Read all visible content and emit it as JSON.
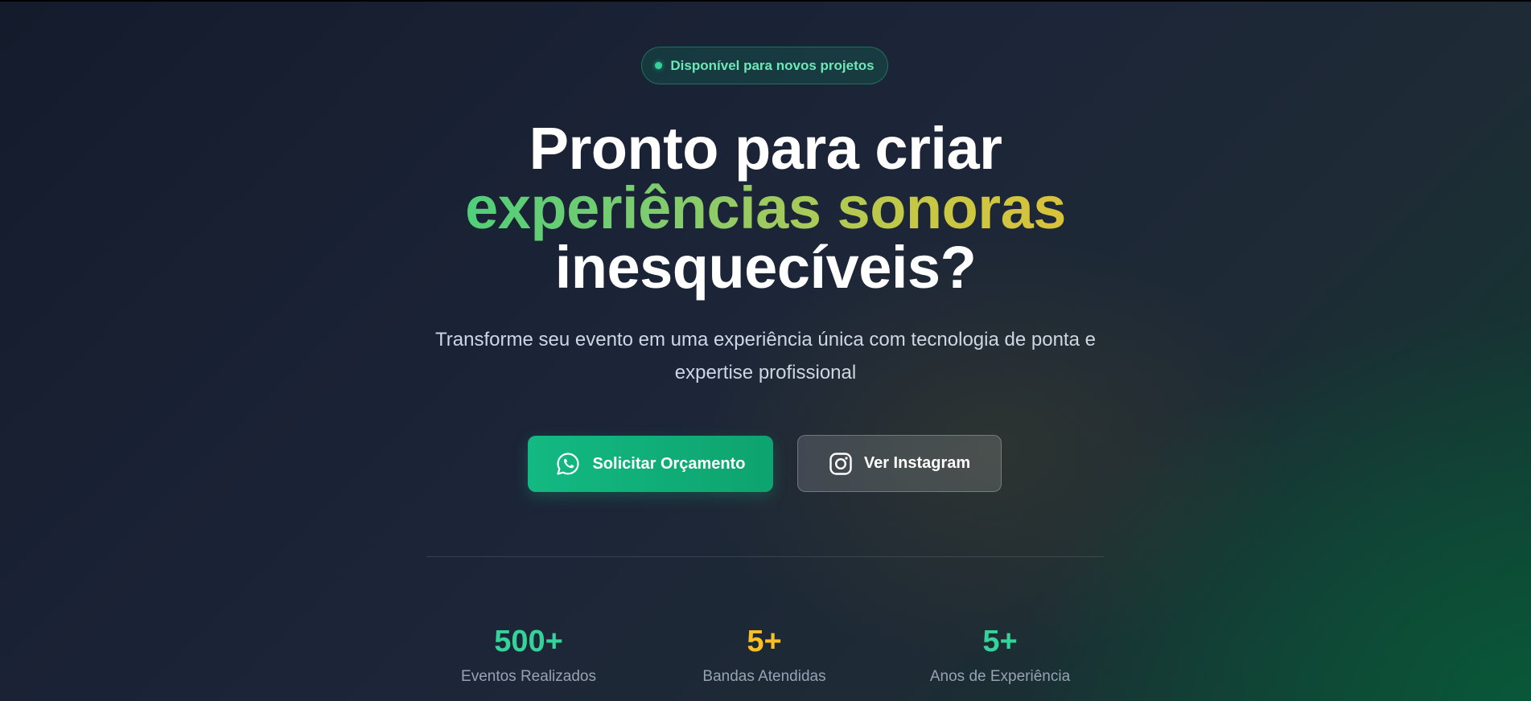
{
  "badge": {
    "text": "Disponível para novos projetos"
  },
  "headline": {
    "line1": "Pronto para criar",
    "line2": "experiências sonoras",
    "line3": "inesquecíveis?"
  },
  "subtitle": "Transforme seu evento em uma experiência única com tecnologia de ponta e expertise profissional",
  "buttons": {
    "primary": {
      "label": "Solicitar Orçamento",
      "icon": "whatsapp-icon"
    },
    "secondary": {
      "label": "Ver Instagram",
      "icon": "instagram-icon"
    }
  },
  "stats": [
    {
      "value": "500+",
      "label": "Eventos Realizados",
      "color": "#34d399"
    },
    {
      "value": "5+",
      "label": "Bandas Atendidas",
      "color": "#fbbf24"
    },
    {
      "value": "5+",
      "label": "Anos de Experiência",
      "color": "#34d399"
    }
  ],
  "colors": {
    "accent_green": "#10b981",
    "badge_text": "#6ee7b7",
    "gradient_start": "#4fcf7a",
    "gradient_end": "#d8c23a"
  }
}
